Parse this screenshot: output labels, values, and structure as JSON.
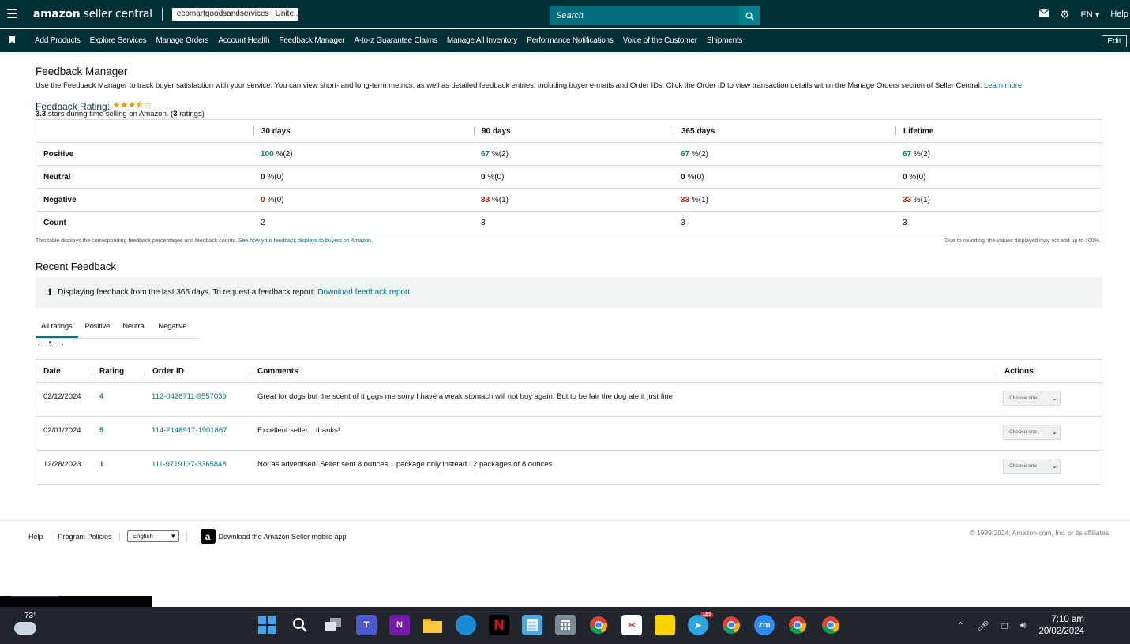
{
  "topbar": {
    "logo_main": "amazon",
    "logo_sub": " seller central",
    "account": "ecomartgoodsandservices | Unite...",
    "search_placeholder": "Search",
    "lang": "EN ▾",
    "help": "Help"
  },
  "nav": {
    "items": [
      "Add Products",
      "Explore Services",
      "Manage Orders",
      "Account Health",
      "Feedback Manager",
      "A-to-z Guarantee Claims",
      "Manage All Inventory",
      "Performance Notifications",
      "Voice of the Customer",
      "Shipments"
    ],
    "edit": "Edit"
  },
  "page": {
    "title": "Feedback Manager",
    "description": "Use the Feedback Manager to track buyer satisfaction with your service. You can view short- and long-term metrics, as well as detailed feedback entries, including buyer e-mails and Order IDs. Click the Order ID to view transaction details within the Manage Orders section of Seller Central.",
    "learn_more": "Learn more",
    "rating_label": "Feedback Rating:",
    "stars_display": "★★★⯪☆",
    "rating_value": "3.3",
    "rating_text": " stars during time selling on Amazon. (",
    "rating_count": "3",
    "rating_text_end": " ratings)"
  },
  "metrics": {
    "columns": [
      "30 days",
      "90 days",
      "365 days",
      "Lifetime"
    ],
    "rows": [
      {
        "label": "Positive",
        "cells": [
          {
            "pct": "100",
            "cnt": " %(2)",
            "color": "green"
          },
          {
            "pct": "67",
            "cnt": " %(2)",
            "color": "green"
          },
          {
            "pct": "67",
            "cnt": " %(2)",
            "color": "green"
          },
          {
            "pct": "67",
            "cnt": " %(2)",
            "color": "green"
          }
        ]
      },
      {
        "label": "Neutral",
        "cells": [
          {
            "pct": "0",
            "cnt": " %(0)",
            "color": "none"
          },
          {
            "pct": "0",
            "cnt": " %(0)",
            "color": "none"
          },
          {
            "pct": "0",
            "cnt": " %(0)",
            "color": "none"
          },
          {
            "pct": "0",
            "cnt": " %(0)",
            "color": "none"
          }
        ]
      },
      {
        "label": "Negative",
        "cells": [
          {
            "pct": "0",
            "cnt": " %(0)",
            "color": "red"
          },
          {
            "pct": "33",
            "cnt": " %(1)",
            "color": "red"
          },
          {
            "pct": "33",
            "cnt": " %(1)",
            "color": "red"
          },
          {
            "pct": "33",
            "cnt": " %(1)",
            "color": "red"
          }
        ]
      },
      {
        "label": "Count",
        "cells": [
          {
            "pct": "",
            "cnt": "2",
            "color": "none"
          },
          {
            "pct": "",
            "cnt": "3",
            "color": "none"
          },
          {
            "pct": "",
            "cnt": "3",
            "color": "none"
          },
          {
            "pct": "",
            "cnt": "3",
            "color": "none"
          }
        ]
      }
    ],
    "note_left": "This table displays the corresponding feedback percentages and feedback counts.",
    "note_left_link": "See how your feedback displays to buyers on Amazon.",
    "note_right": "Due to rounding, the values displayed may not add up to 100%."
  },
  "recent": {
    "title": "Recent Feedback",
    "info_icon": "i",
    "info_text": "Displaying feedback from the last 365 days. To request a feedback report: ",
    "info_link": "Download feedback report",
    "tabs": [
      "All ratings",
      "Positive",
      "Neutral",
      "Negative"
    ],
    "pager_prev": "‹",
    "pager_page": "1",
    "pager_next": "›",
    "headers": [
      "Date",
      "Rating",
      "Order ID",
      "Comments",
      "Actions"
    ],
    "rows": [
      {
        "date": "02/12/2024",
        "rating": "4",
        "rating_color": "green",
        "order": "112-0426711-9557039",
        "comment": "Great for dogs but the scent of it gags me sorry I have a weak stomach will not buy again. But to be fair the dog ate it just fine",
        "action": "Choose one"
      },
      {
        "date": "02/01/2024",
        "rating": "5",
        "rating_color": "green",
        "order": "114-2148917-1901867",
        "comment": "Excellent seller....thanks!",
        "action": "Choose one"
      },
      {
        "date": "12/28/2023",
        "rating": "1",
        "rating_color": "red",
        "order": "111-9719137-3365848",
        "comment": "Not as advertised. Seller sent 8 ounces 1 package only instead 12 packages of 8 ounces",
        "action": "Choose one"
      }
    ]
  },
  "footer": {
    "help": "Help",
    "policies": "Program Policies",
    "language": "English",
    "app_icon": "a",
    "app_text": "Download the Amazon Seller mobile app",
    "copyright": "© 1999-2024, Amazon.com, Inc. or its affiliates"
  },
  "taskbar": {
    "temperature": "73°",
    "time": "7:10 am",
    "date": "20/02/2024",
    "telegram_badge": "185",
    "zoom_label": "zm",
    "onenote_label": "N",
    "teams_label": "T",
    "netflix_label": "N"
  },
  "colors": {
    "brand_dark": "#002f36",
    "search_bg": "#006e7f",
    "link": "#007185",
    "positive": "#067d62",
    "negative": "#b12704"
  }
}
